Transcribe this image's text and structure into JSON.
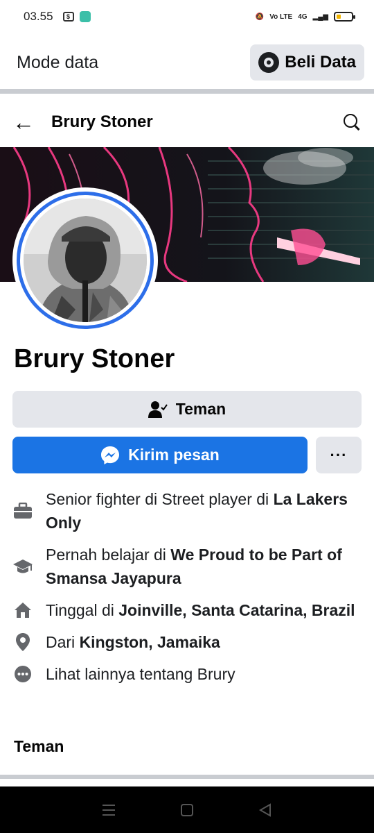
{
  "status_bar": {
    "time": "03.55",
    "network": "4G"
  },
  "data_banner": {
    "label": "Mode data",
    "button": "Beli Data"
  },
  "header": {
    "title": "Brury Stoner"
  },
  "profile": {
    "name": "Brury Stoner",
    "friend_button": "Teman",
    "message_button": "Kirim pesan",
    "more_button": "···"
  },
  "details": [
    {
      "icon": "briefcase-icon",
      "prefix": "Senior fighter di Street player di ",
      "bold": "La Lakers Only"
    },
    {
      "icon": "graduation-cap-icon",
      "prefix": "Pernah belajar di ",
      "bold": "We Proud to be Part of Smansa Jayapura"
    },
    {
      "icon": "home-icon",
      "prefix": "Tinggal di ",
      "bold": "Joinville, Santa Catarina, Brazil"
    },
    {
      "icon": "location-pin-icon",
      "prefix": "Dari ",
      "bold": "Kingston, Jamaika"
    },
    {
      "icon": "more-dots-icon",
      "prefix": "Lihat lainnya tentang Brury",
      "bold": ""
    }
  ],
  "friends_section": {
    "title": "Teman"
  },
  "colors": {
    "primary": "#1b74e4",
    "secondary_btn": "#e4e6eb",
    "avatar_ring": "#2d6ee9"
  }
}
